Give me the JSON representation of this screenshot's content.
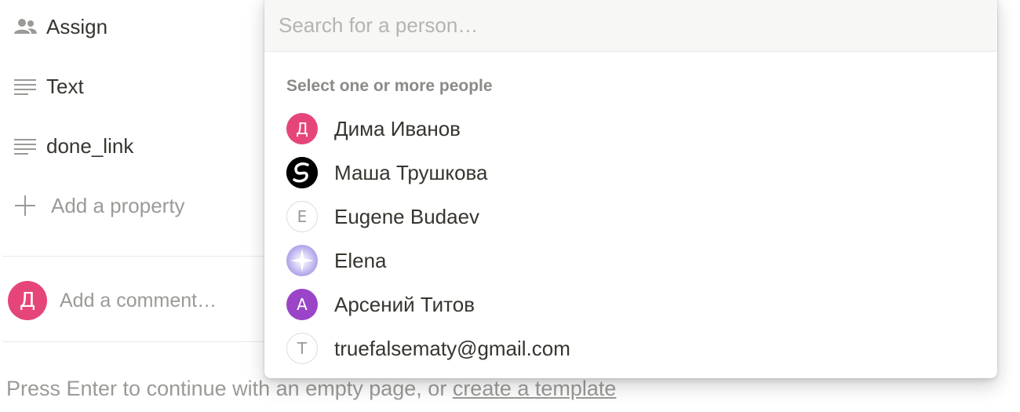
{
  "properties": [
    {
      "label": "Assign",
      "icon": "people-icon"
    },
    {
      "label": "Text",
      "icon": "text-lines-icon"
    },
    {
      "label": "done_link",
      "icon": "text-lines-icon"
    }
  ],
  "add_property": {
    "label": "Add a property",
    "icon": "plus-icon"
  },
  "comment": {
    "avatar_letter": "Д",
    "placeholder": "Add a comment…"
  },
  "footer": {
    "prefix": "Press Enter to continue with an empty page, or ",
    "link": "create a template"
  },
  "dropdown": {
    "search_placeholder": "Search for a person…",
    "section_label": "Select one or more people",
    "people": [
      {
        "name": "Дима Иванов",
        "avatar": "Д",
        "style": "pink"
      },
      {
        "name": "Маша Трушкова",
        "avatar": "",
        "style": "black-swirl"
      },
      {
        "name": "Eugene Budaev",
        "avatar": "E",
        "style": "outline"
      },
      {
        "name": "Elena",
        "avatar": "",
        "style": "sparkle"
      },
      {
        "name": "Арсений Титов",
        "avatar": "А",
        "style": "purple"
      },
      {
        "name": "truefalsematy@gmail.com",
        "avatar": "T",
        "style": "outline"
      }
    ]
  },
  "colors": {
    "accent_pink": "#e6457a",
    "accent_purple": "#9a44c7",
    "muted_text": "#9b9a97"
  }
}
